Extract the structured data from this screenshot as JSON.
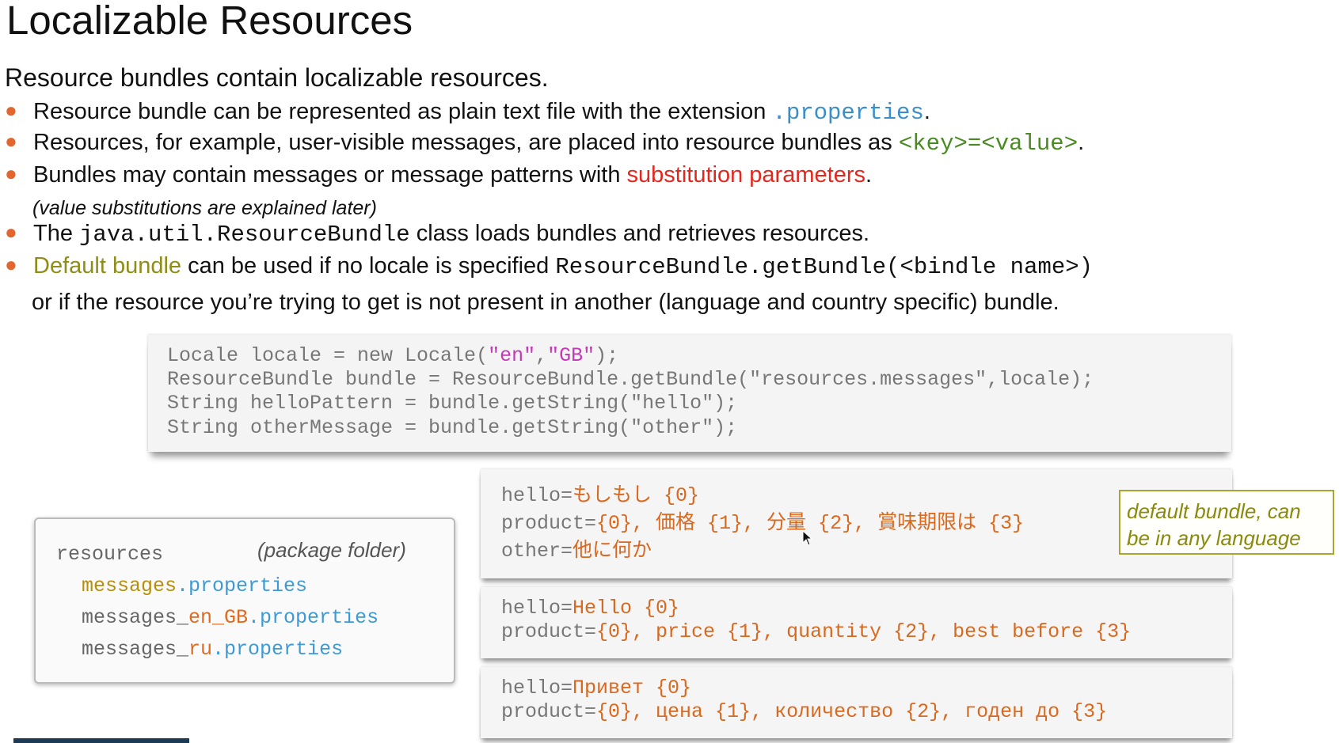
{
  "title": "Localizable Resources",
  "intro": "Resource bundles contain localizable resources.",
  "bullets": {
    "b1": {
      "text": "Resource bundle can be represented as plain text file with the extension ",
      "code": ".properties",
      "after": "."
    },
    "b2": {
      "text": "Resources, for example, user-visible messages, are placed into resource bundles as ",
      "code": "<key>=<value>",
      "after": "."
    },
    "b3": {
      "text": "Bundles may contain messages or message patterns with ",
      "highlight": "substitution parameters",
      "after": "."
    },
    "b3_note": "(value substitutions are explained later)",
    "b4": {
      "pre": "The ",
      "code": "java.util.ResourceBundle",
      "text": " class loads bundles and retrieves resources."
    },
    "b5": {
      "highlight": "Default bundle",
      "text": " can be used if no locale is specified ",
      "code": "ResourceBundle.getBundle(<bindle name>)"
    },
    "b5_cont": "or if the resource you’re trying to get is not present in another (language and country specific) bundle."
  },
  "code": {
    "l1_a": "Locale locale = new Locale(",
    "l1_s1": "\"en\"",
    "l1_c": ",",
    "l1_s2": "\"GB\"",
    "l1_b": ");",
    "l2": "ResourceBundle bundle = ResourceBundle.getBundle(\"resources.messages\",locale);",
    "l3": "String helloPattern = bundle.getString(\"hello\");",
    "l4": "String otherMessage = bundle.getString(\"other\");"
  },
  "resources": {
    "folder": "resources",
    "folder_note": "(package folder)",
    "f1": {
      "name": "messages",
      "ext": ".properties"
    },
    "f2": {
      "name": "messages_",
      "locale": "en_GB",
      "ext": ".properties"
    },
    "f3": {
      "name": "messages_",
      "locale": "ru",
      "ext": ".properties"
    }
  },
  "bundle_default": {
    "k1": "hello=",
    "v1": "もしもし {0}",
    "k2": "product=",
    "v2": "{0}, 価格 {1}, 分量 {2}, 賞味期限は {3}",
    "k3": "other=",
    "v3": "他に何か"
  },
  "bundle_en": {
    "k1": "hello=",
    "v1": "Hello {0}",
    "k2": "product=",
    "v2": "{0}, price {1}, quantity {2}, best before {3}"
  },
  "bundle_ru": {
    "k1": "hello=",
    "v1": "Привет {0}",
    "k2": "product=",
    "v2": "{0}, цена {1}, количество {2}, годен до {3}"
  },
  "callout": {
    "line1": "default bundle, can",
    "line2": "be in any language"
  }
}
